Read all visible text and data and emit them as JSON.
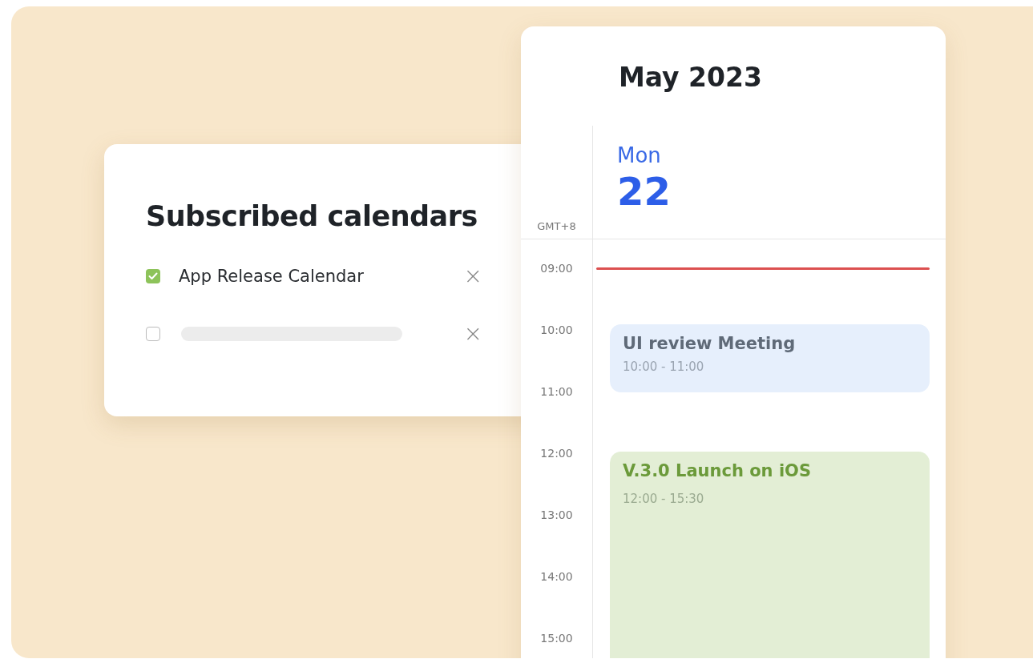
{
  "subscribed_calendars": {
    "title": "Subscribed calendars",
    "items": [
      {
        "kind": "named",
        "label": "App Release Calendar",
        "checked": true,
        "remove": "×"
      },
      {
        "kind": "loading",
        "checked": false,
        "remove": "×"
      }
    ]
  },
  "calendar": {
    "month": "May 2023",
    "timezone": "GMT+8",
    "day_name": "Mon",
    "day_number": "22",
    "hours": [
      "09:00",
      "10:00",
      "11:00",
      "12:00",
      "13:00",
      "14:00",
      "15:00"
    ],
    "events": [
      {
        "kind": "meeting",
        "title": "UI review Meeting",
        "time": "10:00 - 11:00",
        "color": "#e6effc"
      },
      {
        "kind": "release",
        "title": "V.3.0 Launch on iOS",
        "time": "12:00 - 15:30",
        "color": "#e3eed5"
      }
    ]
  }
}
